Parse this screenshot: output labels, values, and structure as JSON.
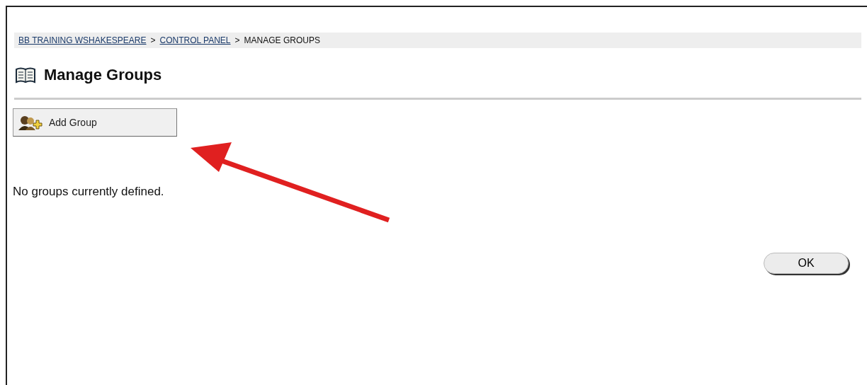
{
  "breadcrumb": [
    {
      "label": "BB TRAINING WSHAKESPEARE",
      "kind": "link"
    },
    {
      "label": ">",
      "kind": "separator"
    },
    {
      "label": "CONTROL PANEL",
      "kind": "link"
    },
    {
      "label": ">",
      "kind": "separator"
    },
    {
      "label": "MANAGE GROUPS",
      "kind": "current"
    }
  ],
  "title": "Manage Groups",
  "add_button": "Add Group",
  "message": "No groups currently defined.",
  "ok_button": "OK"
}
